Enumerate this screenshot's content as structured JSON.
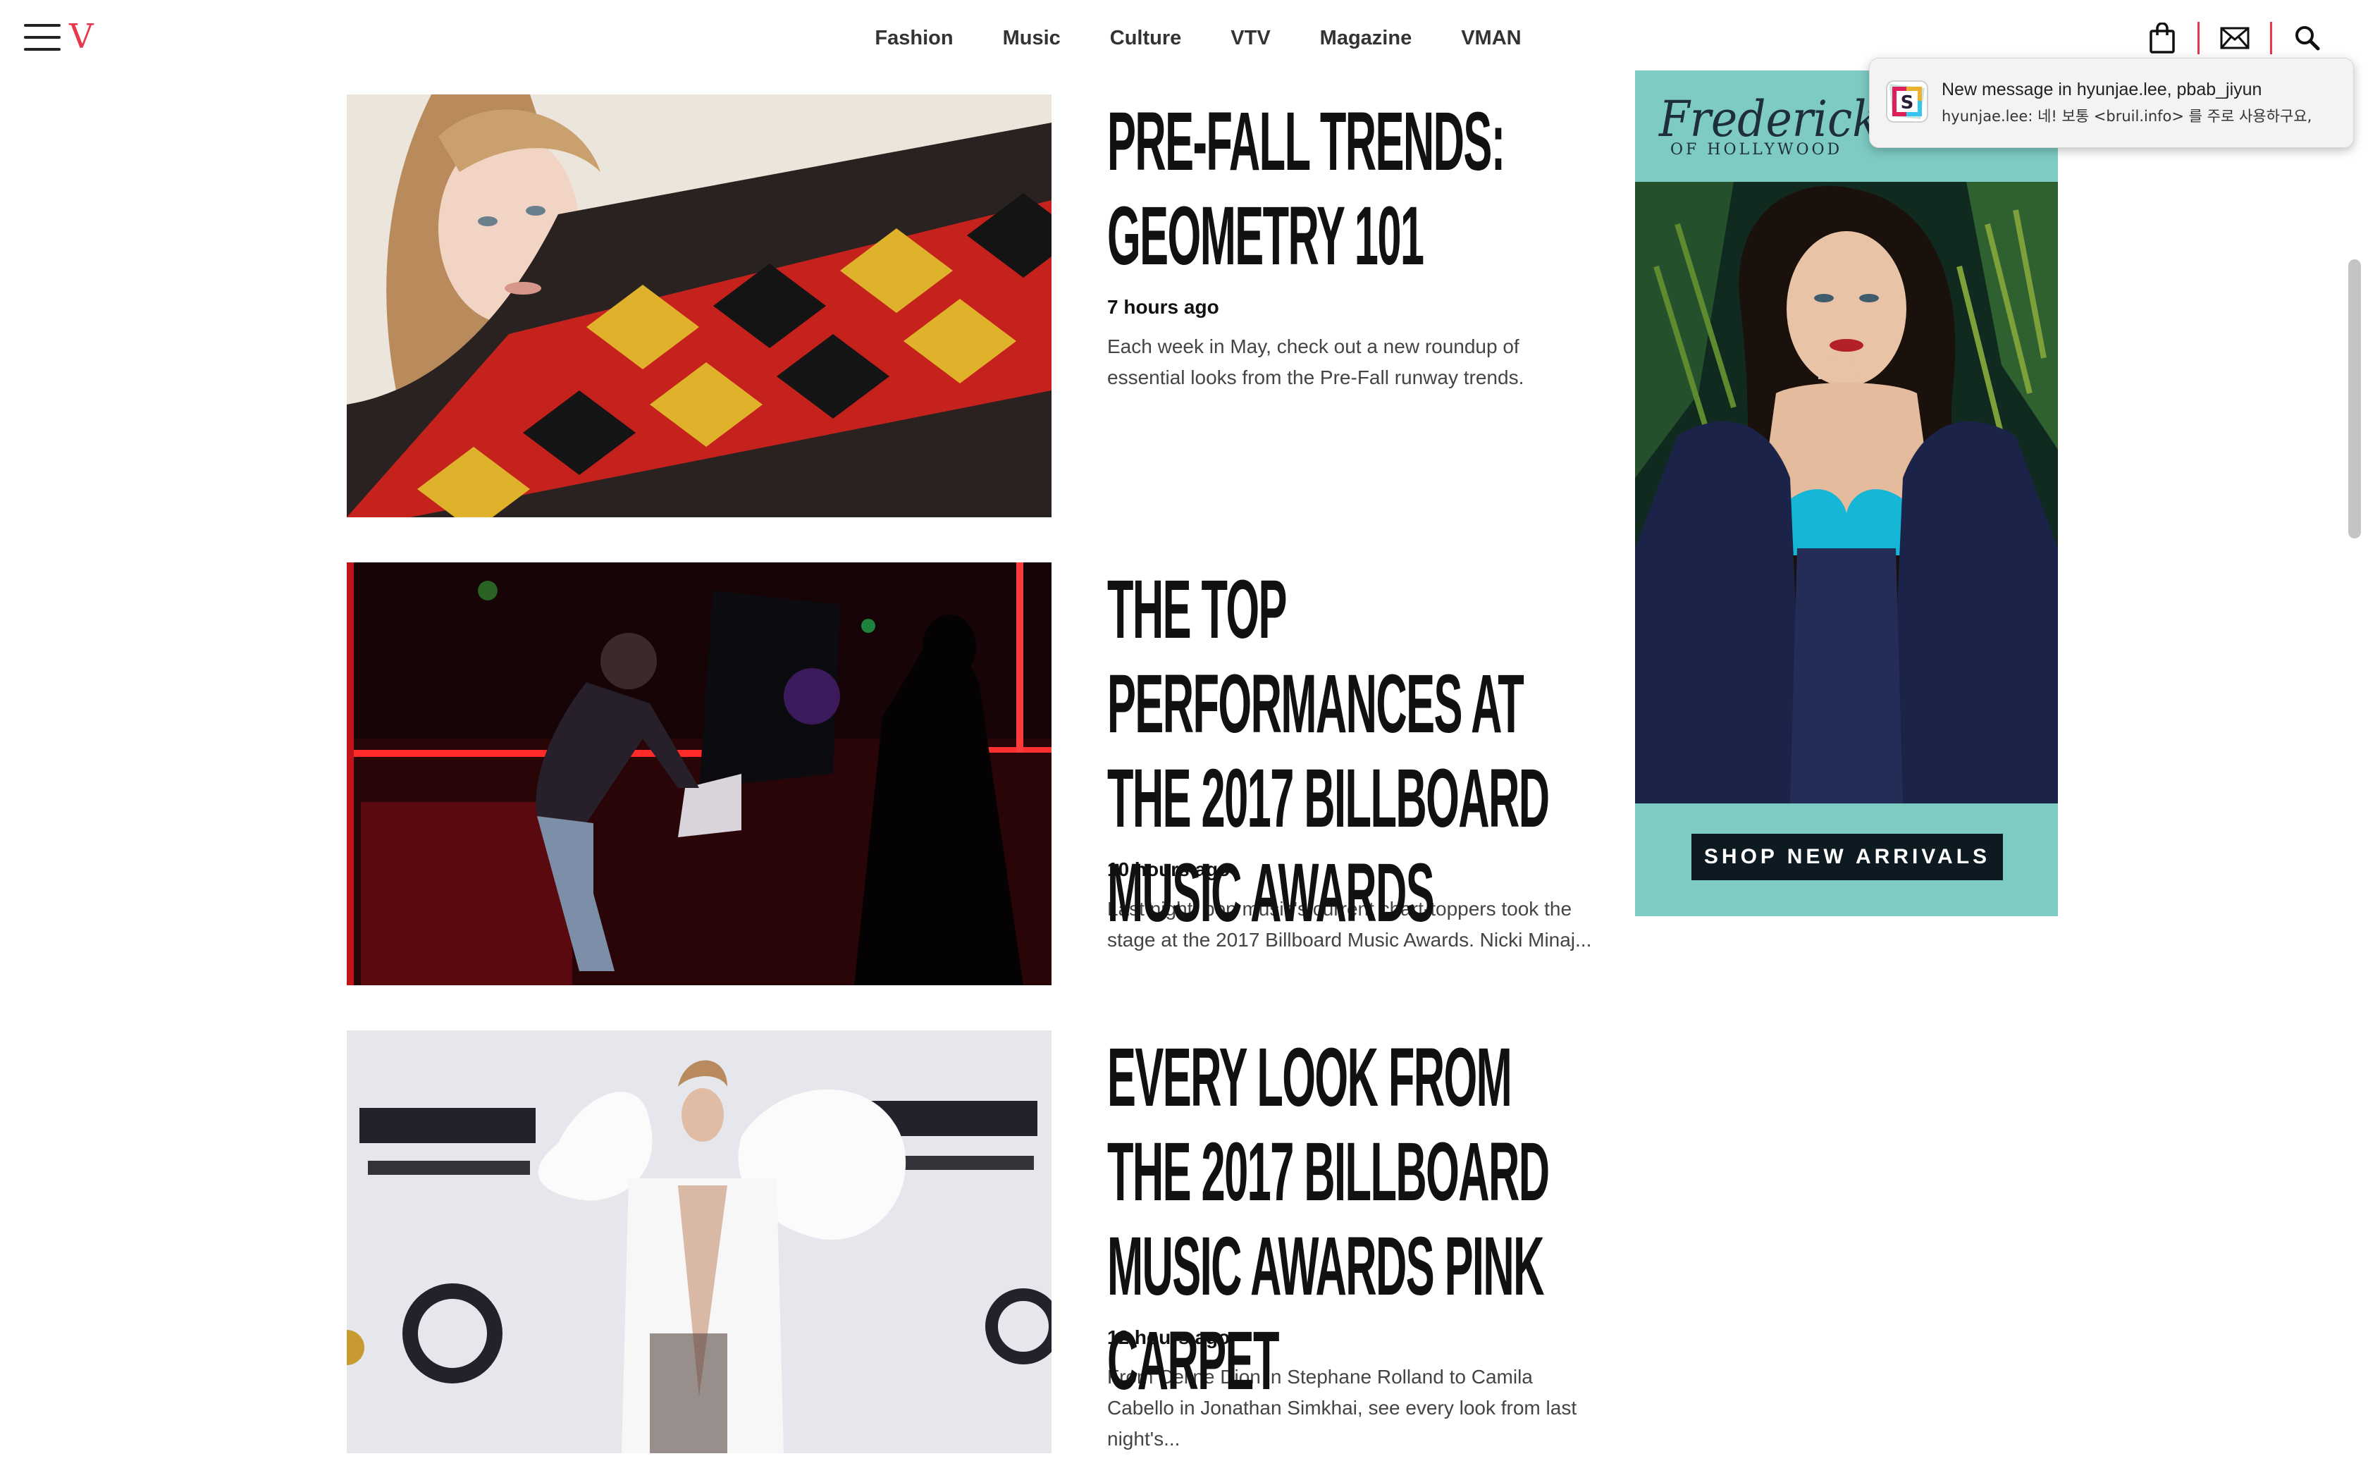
{
  "header": {
    "logo": "V",
    "nav": [
      "Fashion",
      "Music",
      "Culture",
      "VTV",
      "Magazine",
      "VMAN"
    ]
  },
  "articles": [
    {
      "headline": "Pre-Fall Trends: Geometry 101",
      "time": "7 hours ago",
      "excerpt": "Each week in May, check out a new roundup of essential looks from the Pre-Fall runway trends."
    },
    {
      "headline": "The Top Performances at the 2017 Billboard Music Awards",
      "time": "10 hours ago",
      "excerpt": "Last night, pop music's current chart-toppers took the stage at the 2017 Billboard Music Awards. Nicki Minaj..."
    },
    {
      "headline": "Every Look From the 2017 Billboard Music Awards Pink Carpet",
      "time": "12 hours ago",
      "excerpt": "From Celine Dion in Stephane Rolland to Camila Cabello in Jonathan Simkhai, see every look from last night's..."
    }
  ],
  "ad": {
    "brand": "Frederick's",
    "brand_sub": "OF HOLLYWOOD",
    "button": "SHOP NEW ARRIVALS"
  },
  "notification": {
    "title": "New message in hyunjae.lee, pbab_jiyun",
    "text": "hyunjae.lee: 네! 보통 <bruil.info> 를 주로 사용하구요,"
  },
  "colors": {
    "brand_red": "#e8384f",
    "ad_teal": "#7dcbc3",
    "text_dark": "#111111"
  },
  "icons": [
    "menu-icon",
    "bag-icon",
    "mail-icon",
    "search-icon",
    "slack-icon"
  ]
}
